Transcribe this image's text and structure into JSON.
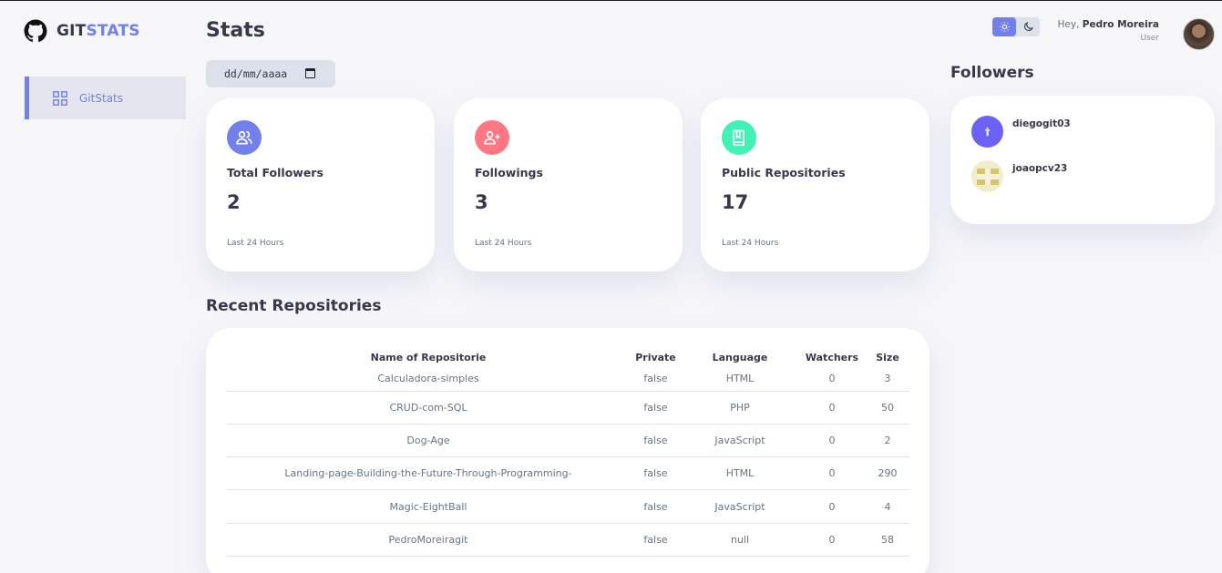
{
  "brand": {
    "part1": "GIT",
    "part2": "STATS"
  },
  "sidebar": {
    "items": [
      {
        "label": "GitStats",
        "icon": "grid-icon"
      }
    ]
  },
  "page": {
    "title": "Stats"
  },
  "date_filter": {
    "placeholder": "dd/mm/aaaa"
  },
  "cards": [
    {
      "label": "Total Followers",
      "value": "2",
      "sub": "Last 24 Hours",
      "icon": "users-icon",
      "color": "#7380ec"
    },
    {
      "label": "Followings",
      "value": "3",
      "sub": "Last 24 Hours",
      "icon": "user-plus-icon",
      "color": "#ff7782"
    },
    {
      "label": "Public Repositories",
      "value": "17",
      "sub": "Last 24 Hours",
      "icon": "book-icon",
      "color": "#41f1b6"
    }
  ],
  "repos": {
    "title": "Recent Repositories",
    "columns": [
      "Name of Repositorie",
      "Private",
      "Language",
      "Watchers",
      "Size"
    ],
    "rows": [
      [
        "Calculadora-simples",
        "false",
        "HTML",
        "0",
        "3"
      ],
      [
        "CRUD-com-SQL",
        "false",
        "PHP",
        "0",
        "50"
      ],
      [
        "Dog-Age",
        "false",
        "JavaScript",
        "0",
        "2"
      ],
      [
        "Landing-page-Building-the-Future-Through-Programming-",
        "false",
        "HTML",
        "0",
        "290"
      ],
      [
        "Magic-EightBall",
        "false",
        "JavaScript",
        "0",
        "4"
      ],
      [
        "PedroMoreiragit",
        "false",
        "null",
        "0",
        "58"
      ]
    ]
  },
  "profile": {
    "greeting": "Hey, ",
    "name": "Pedro Moreira",
    "role": "User"
  },
  "theme": {
    "active": "light"
  },
  "followers": {
    "title": "Followers",
    "items": [
      {
        "name": "diegogit03"
      },
      {
        "name": "joaopcv23"
      }
    ]
  }
}
